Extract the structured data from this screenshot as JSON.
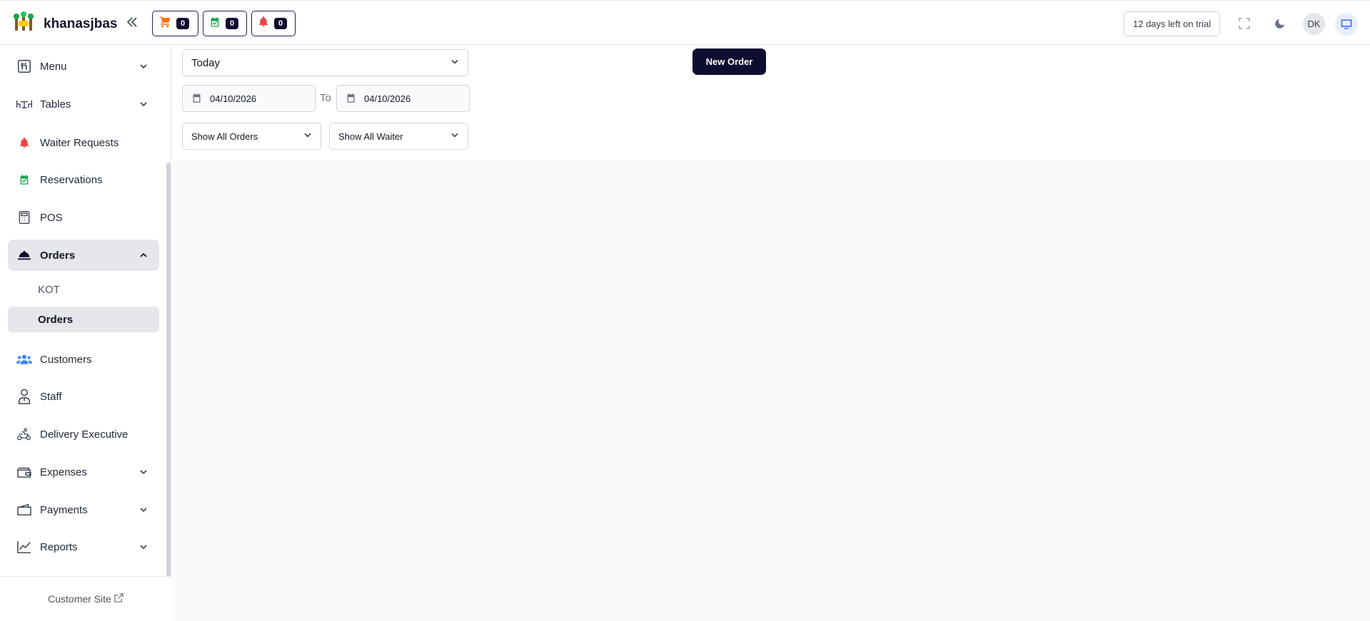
{
  "header": {
    "brand_name": "khanasjbas",
    "cart_count": "0",
    "reservation_count": "0",
    "notification_count": "0",
    "trial_text": "12 days left on trial",
    "avatar_initials": "DK"
  },
  "sidebar": {
    "items": {
      "menu": "Menu",
      "tables": "Tables",
      "waiter_requests": "Waiter Requests",
      "reservations": "Reservations",
      "pos": "POS",
      "orders": "Orders",
      "customers": "Customers",
      "staff": "Staff",
      "delivery_executive": "Delivery Executive",
      "expenses": "Expenses",
      "payments": "Payments",
      "reports": "Reports"
    },
    "orders_sub": {
      "kot": "KOT",
      "orders": "Orders"
    },
    "customer_site": "Customer Site"
  },
  "filters": {
    "period": "Today",
    "date_from": "04/10/2026",
    "to_label": "To",
    "date_to": "04/10/2026",
    "order_filter": "Show All Orders",
    "waiter_filter": "Show All Waiter"
  },
  "actions": {
    "new_order": "New Order"
  },
  "colors": {
    "primary_dark": "#0e0c2f",
    "cart_orange": "#f97316",
    "reservation_green": "#16a34a",
    "bell_red": "#ef4444",
    "customers_blue": "#3b82f6"
  }
}
